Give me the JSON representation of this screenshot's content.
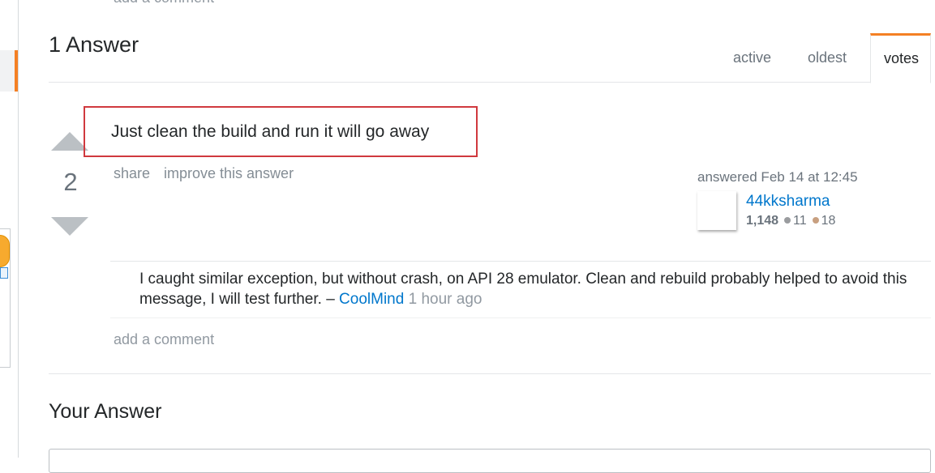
{
  "previous_comment": {
    "add_comment": "add a comment"
  },
  "answers_header": {
    "title": "1 Answer",
    "tabs": [
      {
        "label": "active"
      },
      {
        "label": "oldest"
      },
      {
        "label": "votes",
        "selected": true
      }
    ]
  },
  "answer": {
    "vote_count": "2",
    "body": "Just clean the build and run it will go away",
    "menu": {
      "share": "share",
      "improve": "improve this answer"
    },
    "signature": {
      "answered": "answered Feb 14 at 12:45",
      "username": "44kksharma",
      "reputation": "1,148",
      "silver_badges": "11",
      "bronze_badges": "18"
    },
    "comments": [
      {
        "text": "I caught similar exception, but without crash, on API 28 emulator. Clean and rebuild probably helped to avoid this message, I will test further.",
        "separator": " – ",
        "user": "CoolMind",
        "date": "1 hour ago"
      }
    ],
    "add_comment": "add a comment"
  },
  "your_answer": {
    "title": "Your Answer"
  },
  "colors": {
    "accent": "#f48024",
    "link": "#0077cc",
    "highlight_border": "#d0393e",
    "silver": "#9a9c9f",
    "bronze": "#c8a080"
  }
}
